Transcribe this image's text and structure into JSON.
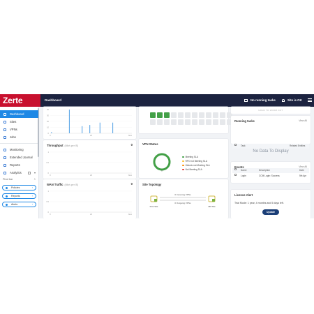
{
  "brand": {
    "name": "Zerte",
    "color": "#c8102e"
  },
  "header": {
    "title": "Dashboard",
    "tasks_label": "No running tasks",
    "site_status": "Site is OK",
    "tasks_icon": "tasks-icon",
    "status_icon": "bell-icon",
    "menu_icon": "hamburger-icon"
  },
  "sidebar": {
    "items": [
      {
        "label": "Dashboard",
        "icon": "dashboard-icon",
        "active": true
      },
      {
        "label": "Sites",
        "icon": "sites-icon"
      },
      {
        "label": "VPNs",
        "icon": "vpn-icon"
      },
      {
        "label": "Jobs",
        "icon": "jobs-icon"
      },
      {
        "label": "Monitoring",
        "icon": "monitoring-icon"
      },
      {
        "label": "Extended Journal",
        "icon": "journal-icon"
      },
      {
        "label": "Reports",
        "icon": "reports-icon"
      },
      {
        "label": "Analytics",
        "icon": "analytics-icon"
      }
    ],
    "pivot_label": "Pivot bar",
    "pills": [
      "Policies",
      "Reports",
      "Alerts"
    ]
  },
  "cards": {
    "throughput": {
      "title": "Throughput",
      "subtitle": "(Mb/s per IS)",
      "count": "0"
    },
    "wan_traffic": {
      "title": "WAN Traffic",
      "subtitle": "(Mb/s per IS)",
      "count": "0"
    },
    "vpn_status": {
      "title": "VPN Status"
    },
    "site_topology": {
      "title": "Site Topology",
      "left_site": "First Site",
      "right_site": "HR Site",
      "top_label": "0 Incoming VPNs",
      "bottom_label": "0 Outgoing VPNs"
    },
    "map_hint": "HOLD TO ZOOM OUT",
    "running_tasks": {
      "title": "Running tasks",
      "view_all": "View All",
      "columns": [
        "",
        "Task",
        "Related Entities"
      ],
      "empty": "No Data To Display"
    },
    "events": {
      "title": "Events",
      "view_all": "View All",
      "columns": [
        "",
        "Name",
        "Description",
        "Date"
      ],
      "rows": [
        {
          "name": "Login",
          "description": "CCM Login: Success",
          "date": "5th Apr"
        }
      ]
    },
    "license": {
      "title": "License Alert",
      "message": "Trial Mode: 1 year, 4 months and 5 days left.",
      "button": "Update"
    }
  },
  "vpn_legend": [
    {
      "label": "Meeting SLA",
      "color": "#43a047"
    },
    {
      "label": "RPO not Meeting SLA",
      "color": "#fbc02d"
    },
    {
      "label": "Historic not Meeting SLA",
      "color": "#fb8c00"
    },
    {
      "label": "Not Meeting SLA",
      "color": "#e53935"
    }
  ],
  "chart_data": [
    {
      "type": "bar",
      "title": "",
      "x_ticks": [
        "0",
        "2d",
        "Now"
      ],
      "y_ticks": [
        "40",
        "30",
        "20",
        "10",
        "0"
      ],
      "values": [
        2,
        0,
        0,
        0,
        0,
        0,
        0,
        40,
        0,
        0,
        0,
        0,
        12,
        0,
        0,
        14,
        0,
        0,
        0,
        18,
        0,
        0,
        0,
        0,
        18,
        0,
        0,
        0,
        0,
        0,
        0,
        0
      ],
      "ylim": [
        0,
        40
      ]
    },
    {
      "type": "line",
      "title": "Throughput",
      "x_ticks": [
        "0",
        "2d",
        "Now"
      ],
      "y_ticks": [
        "1",
        "0.5",
        "0"
      ],
      "values": []
    },
    {
      "type": "line",
      "title": "WAN Traffic",
      "x_ticks": [
        "0",
        "2d",
        "Now"
      ],
      "y_ticks": [
        "1",
        "0.5",
        "0"
      ],
      "values": []
    }
  ],
  "sites_grid": {
    "green_count": 3,
    "total": 24,
    "green": "#43a047",
    "grey": "#e6e8eb"
  }
}
